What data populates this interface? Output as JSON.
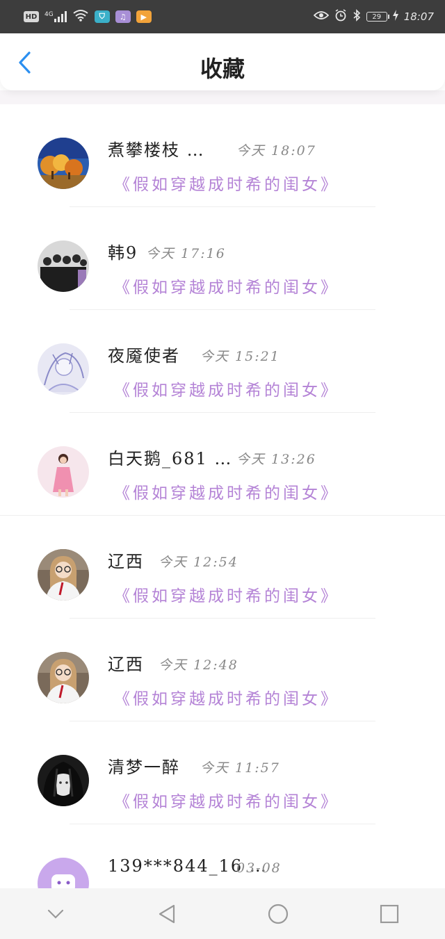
{
  "status_bar": {
    "hd_label": "HD",
    "network_label": "4G",
    "battery_level": "29",
    "time": "18:07"
  },
  "header": {
    "title": "收藏"
  },
  "favorites": [
    {
      "user": "煮攀楼枝 …",
      "time": "今天 18:07",
      "book": "《假如穿越成时希的闺女》",
      "avatar": "autumn-trees-avatar"
    },
    {
      "user": "韩9",
      "time": "今天 17:16",
      "book": "《假如穿越成时希的闺女》",
      "avatar": "group-photo-avatar"
    },
    {
      "user": "夜魇使者",
      "time": "今天 15:21",
      "book": "《假如穿越成时希的闺女》",
      "avatar": "anime-sketch-avatar"
    },
    {
      "user": "白天鹅_681 …",
      "time": "今天 13:26",
      "book": "《假如穿越成时希的闺女》",
      "avatar": "pink-dress-avatar"
    },
    {
      "user": "辽西",
      "time": "今天 12:54",
      "book": "《假如穿越成时希的闺女》",
      "avatar": "girl-glasses-avatar"
    },
    {
      "user": "辽西",
      "time": "今天 12:48",
      "book": "《假如穿越成时希的闺女》",
      "avatar": "girl-glasses-avatar"
    },
    {
      "user": "清梦一醉",
      "time": "今天 11:57",
      "book": "《假如穿越成时希的闺女》",
      "avatar": "dark-anime-avatar"
    },
    {
      "user": "139***844_16 …",
      "time": "03-08",
      "book": "",
      "avatar": "purple-default-avatar"
    }
  ],
  "colors": {
    "accent_blue": "#2b8ff0",
    "book_purple": "#b483d6",
    "status_bar": "#3d3d3d"
  },
  "nav": {
    "icons": [
      "chevron-down-icon",
      "back-triangle-icon",
      "home-circle-icon",
      "recents-square-icon"
    ]
  }
}
